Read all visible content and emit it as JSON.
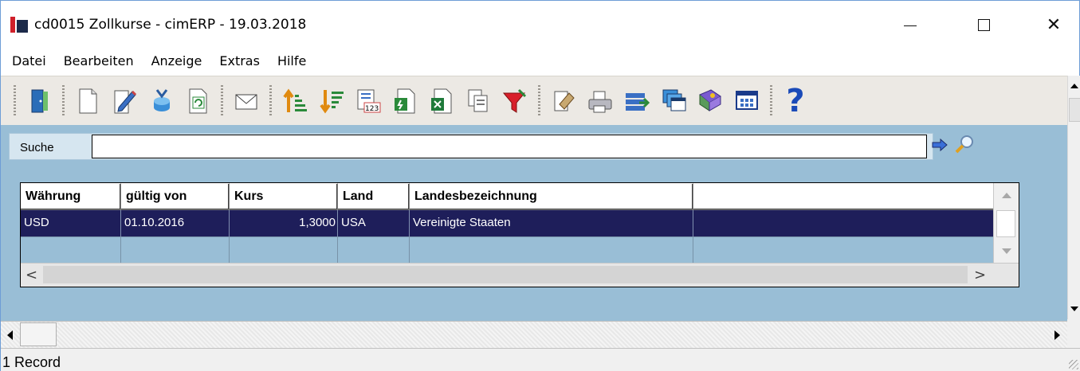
{
  "window": {
    "title": "cd0015 Zollkurse - cimERP - 19.03.2018",
    "controls": {
      "minimize": "minimize-icon",
      "maximize": "maximize-icon",
      "close": "✕"
    }
  },
  "menu": {
    "items": [
      "Datei",
      "Bearbeiten",
      "Anzeige",
      "Extras",
      "Hilfe"
    ]
  },
  "toolbar": {
    "icons": [
      "exit-door-icon",
      "new-document-icon",
      "edit-pencil-icon",
      "save-to-db-icon",
      "refresh-icon",
      "mail-icon",
      "sort-ascending-icon",
      "sort-descending-icon",
      "number-format-icon",
      "export-icon",
      "excel-export-icon",
      "copy-icon",
      "filter-funnel-icon",
      "hand-tool-icon",
      "print-icon",
      "transfer-icon",
      "windows-icon",
      "book-icon",
      "table-icon",
      "help-icon"
    ],
    "help_symbol": "?"
  },
  "search": {
    "label": "Suche",
    "value": "",
    "go_icon": "arrow-right-icon",
    "find_icon": "magnifier-icon"
  },
  "grid": {
    "columns": [
      "Währung",
      "gültig von",
      "Kurs",
      "Land",
      "Landesbezeichnung",
      ""
    ],
    "rows": [
      {
        "waehrung": "USD",
        "gueltig_von": "01.10.2016",
        "kurs": "1,3000",
        "land": "USA",
        "bezeichnung": "Vereinigte Staaten",
        "extra": ""
      }
    ],
    "hscroll_left": "<",
    "hscroll_right": ">"
  },
  "status": {
    "text": "1 Record"
  },
  "colors": {
    "selected_row": "#1e1e5a",
    "panel_bg": "#99bed6",
    "toolbar_bg": "#ece9e4"
  }
}
